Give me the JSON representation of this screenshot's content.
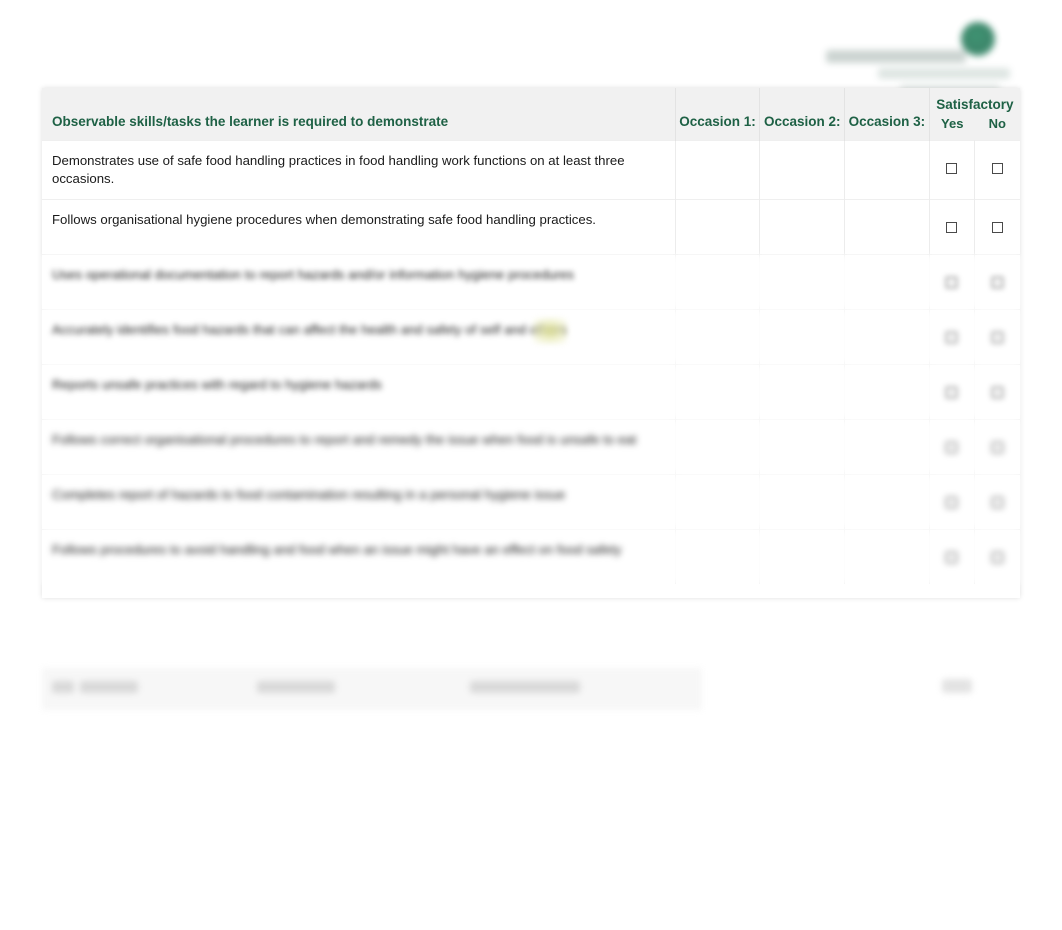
{
  "logo": {
    "name": "organisation-logo",
    "accent_color": "#2d7d5f",
    "legible": false
  },
  "theme": {
    "heading_green": "#1e6145",
    "header_band": "#f1f1f1",
    "grid_line": "#ececec",
    "highlight_yellow": "#dfe296"
  },
  "table": {
    "headers": {
      "task": "Observable skills/tasks the learner is required to demonstrate",
      "occasion_1": "Occasion 1:",
      "occasion_2": "Occasion 2:",
      "occasion_3": "Occasion 3:",
      "satisfactory": "Satisfactory",
      "yes": "Yes",
      "no": "No"
    },
    "rows": [
      {
        "task": "Demonstrates use of safe food handling practices in food handling work functions on at least three occasions.",
        "occasion_1": "",
        "occasion_2": "",
        "occasion_3": "",
        "yes_checked": false,
        "no_checked": false,
        "legible": true,
        "blur": ""
      },
      {
        "task": "Follows organisational hygiene procedures when demonstrating safe food handling practices.",
        "occasion_1": "",
        "occasion_2": "",
        "occasion_3": "",
        "yes_checked": false,
        "no_checked": false,
        "legible": true,
        "blur": ""
      },
      {
        "task": "Uses operational documentation to report hazards and/or information hygiene procedures",
        "occasion_1": "",
        "occasion_2": "",
        "occasion_3": "",
        "yes_checked": false,
        "no_checked": false,
        "legible": false,
        "blur": "b1"
      },
      {
        "task": "Accurately identifies food hazards that can affect the health and safety of self and others",
        "occasion_1": "",
        "occasion_2": "",
        "occasion_3": "",
        "yes_checked": false,
        "no_checked": false,
        "legible": false,
        "blur": "b2"
      },
      {
        "task": "Reports unsafe practices with regard to hygiene hazards",
        "occasion_1": "",
        "occasion_2": "",
        "occasion_3": "",
        "yes_checked": false,
        "no_checked": false,
        "legible": false,
        "blur": "b3"
      },
      {
        "task": "Follows correct organisational procedures to report and remedy the issue when food is unsafe to eat",
        "occasion_1": "",
        "occasion_2": "",
        "occasion_3": "",
        "yes_checked": false,
        "no_checked": false,
        "legible": false,
        "blur": "b4"
      },
      {
        "task": "Completes report of hazards to food contamination resulting in a personal hygiene issue",
        "occasion_1": "",
        "occasion_2": "",
        "occasion_3": "",
        "yes_checked": false,
        "no_checked": false,
        "legible": false,
        "blur": "b5"
      },
      {
        "task": "Follows procedures to avoid handling and food when an issue might have an effect on food safety",
        "occasion_1": "",
        "occasion_2": "",
        "occasion_3": "",
        "yes_checked": false,
        "no_checked": false,
        "legible": false,
        "blur": "b6"
      }
    ]
  },
  "footer": {
    "legible": false,
    "segments": [
      "",
      "",
      "",
      ""
    ],
    "page_marker": ""
  }
}
